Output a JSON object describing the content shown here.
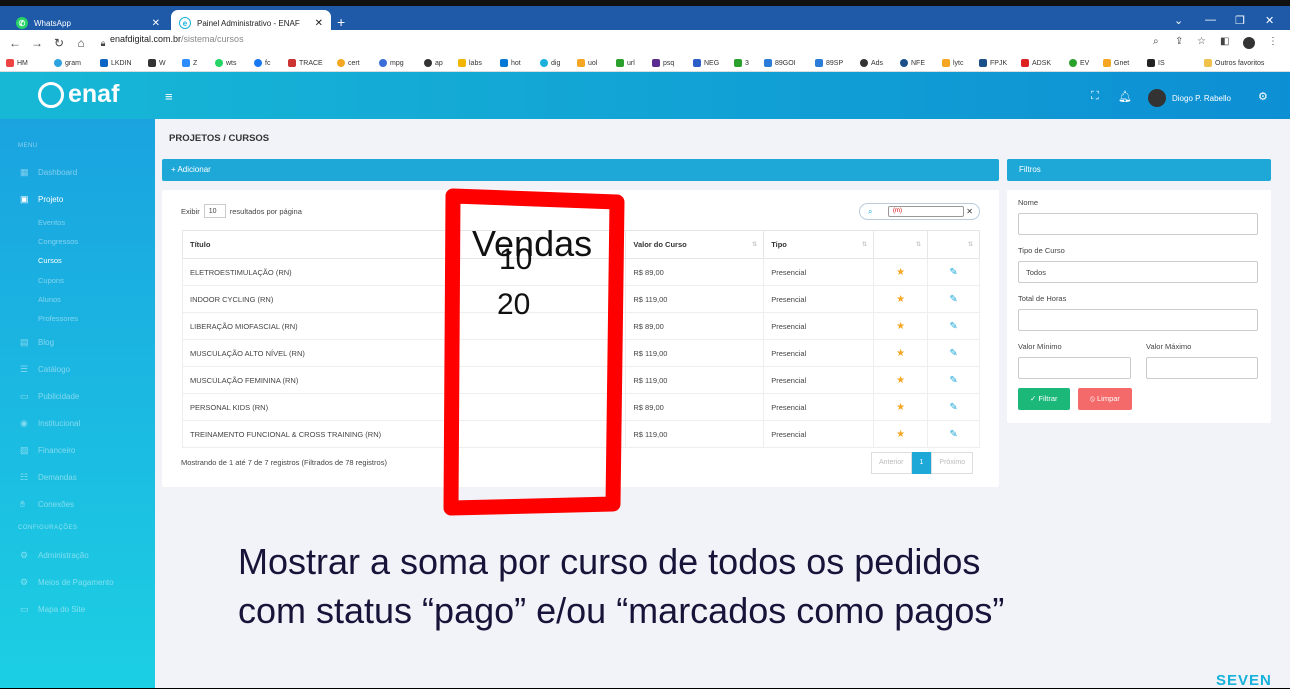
{
  "browser": {
    "tabs": [
      {
        "label": "WhatsApp"
      },
      {
        "label": "Painel Administrativo - ENAF"
      }
    ],
    "url_host": "enafdigital.com.br",
    "url_path": "/sistema/cursos",
    "bookmarks": [
      "HM",
      "gram",
      "LKDIN",
      "W",
      "Z",
      "wts",
      "fc",
      "TRACE",
      "cert",
      "mpg",
      "ap",
      "labs",
      "hot",
      "dig",
      "uol",
      "url",
      "psq",
      "NEG",
      "3",
      "89GOI",
      "89SP",
      "Ads",
      "NFE",
      "lytc",
      "FPJK",
      "ADSK",
      "EV",
      "Gnet",
      "IS",
      "Outros favoritos"
    ]
  },
  "header": {
    "logo_text": "enaf",
    "user_name": "Diogo P. Rabello"
  },
  "sidebar": {
    "menu_label": "MENU",
    "items": [
      {
        "label": "Dashboard"
      },
      {
        "label": "Projeto"
      },
      {
        "label": "Blog"
      },
      {
        "label": "Catálogo"
      },
      {
        "label": "Publicidade"
      },
      {
        "label": "Institucional"
      },
      {
        "label": "Financeiro"
      },
      {
        "label": "Demandas"
      },
      {
        "label": "Conexões"
      }
    ],
    "sub_items": [
      {
        "label": "Eventos"
      },
      {
        "label": "Congressos"
      },
      {
        "label": "Cursos"
      },
      {
        "label": "Cupons"
      },
      {
        "label": "Alunos"
      },
      {
        "label": "Professores"
      }
    ],
    "config_label": "CONFIGURAÇÕES",
    "config_items": [
      {
        "label": "Administração"
      },
      {
        "label": "Meios de Pagamento"
      },
      {
        "label": "Mapa do Site"
      }
    ]
  },
  "main": {
    "breadcrumb": "PROJETOS / CURSOS",
    "add_label": "+ Adicionar",
    "per_page_prefix": "Exibir",
    "per_page_value": "10",
    "per_page_suffix": "resultados por página",
    "search_value": "(m)",
    "columns": [
      "Título",
      "Valor do Curso",
      "Tipo"
    ],
    "rows": [
      {
        "title": "ELETROESTIMULAÇÃO (RN)",
        "price": "R$ 89,00",
        "type": "Presencial"
      },
      {
        "title": "INDOOR CYCLING (RN)",
        "price": "R$ 119,00",
        "type": "Presencial"
      },
      {
        "title": "LIBERAÇÃO MIOFASCIAL (RN)",
        "price": "R$ 89,00",
        "type": "Presencial"
      },
      {
        "title": "MUSCULAÇÃO ALTO NÍVEL (RN)",
        "price": "R$ 119,00",
        "type": "Presencial"
      },
      {
        "title": "MUSCULAÇÃO FEMININA (RN)",
        "price": "R$ 119,00",
        "type": "Presencial"
      },
      {
        "title": "PERSONAL KIDS (RN)",
        "price": "R$ 89,00",
        "type": "Presencial"
      },
      {
        "title": "TREINAMENTO FUNCIONAL & CROSS TRAINING (RN)",
        "price": "R$ 119,00",
        "type": "Presencial"
      }
    ],
    "showing": "Mostrando de 1 até 7 de 7 registros (Filtrados de 78 registros)",
    "pager": {
      "prev": "Anterior",
      "current": "1",
      "next": "Próximo"
    }
  },
  "filters": {
    "title": "Filtros",
    "name_label": "Nome",
    "type_label": "Tipo de Curso",
    "type_value": "Todos",
    "hours_label": "Total de Horas",
    "min_label": "Valor Mínimo",
    "max_label": "Valor Máximo",
    "filter_button": "Filtrar",
    "clear_button": "Limpar"
  },
  "annotation": {
    "column_title": "Vendas",
    "value_1": "10",
    "value_2": "20",
    "note_line_1": "Mostrar a soma por curso de todos os pedidos",
    "note_line_2": "com status “pago” e/ou “marcados como pagos”",
    "color": "#ff0000"
  },
  "footer_brand": "SEVEN"
}
